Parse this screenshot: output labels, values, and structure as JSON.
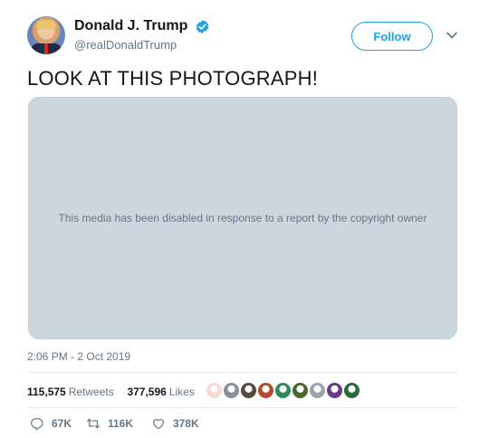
{
  "author": {
    "display_name": "Donald J. Trump",
    "handle": "@realDonaldTrump",
    "verified": true
  },
  "follow_label": "Follow",
  "tweet": {
    "text": "LOOK AT THIS PHOTOGRAPH!",
    "media_message": "This media has been disabled in response to a report by the copyright owner",
    "timestamp": "2:06 PM - 2 Oct 2019"
  },
  "stats": {
    "retweets": "115,575",
    "retweets_label": "Retweets",
    "likes": "377,596",
    "likes_label": "Likes"
  },
  "liker_colors": [
    "#f7d9d0",
    "#8a8f96",
    "#5a4a3a",
    "#b84a2a",
    "#2e8b57",
    "#4a6a2a",
    "#9aa4ad",
    "#6a3a8a",
    "#2a6a3a"
  ],
  "actions": {
    "replies": "67K",
    "retweets": "116K",
    "likes": "378K"
  },
  "colors": {
    "accent": "#1da1f2",
    "muted": "#657786",
    "media_bg": "#ccd6dd"
  }
}
